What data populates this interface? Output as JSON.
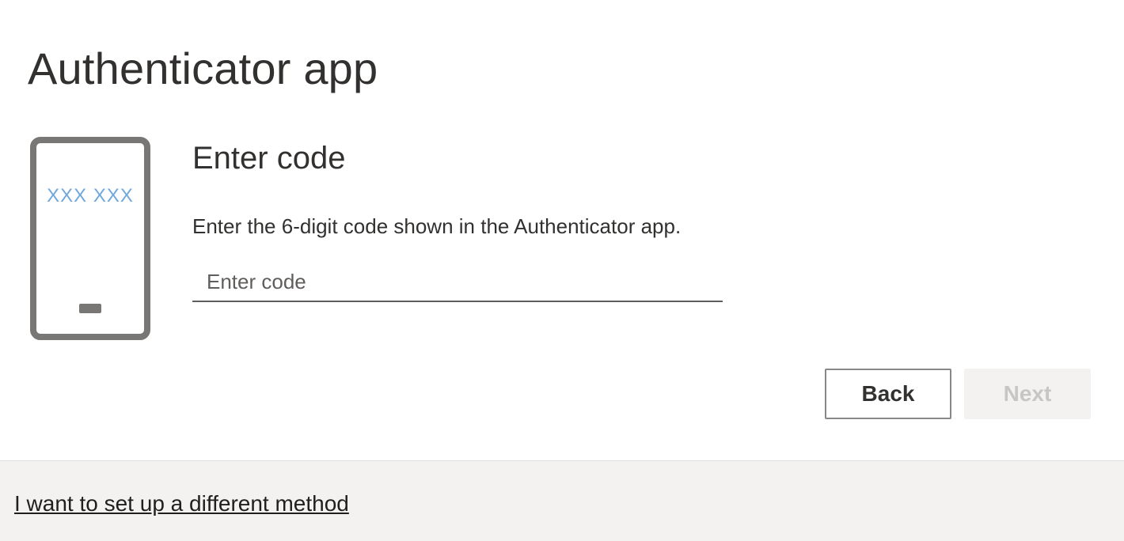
{
  "header": {
    "title": "Authenticator app"
  },
  "illustration": {
    "icon": "phone-icon",
    "code_placeholder": "XXX XXX",
    "accent_color": "#6fa8dc",
    "frame_color": "#797775"
  },
  "form": {
    "title": "Enter code",
    "description": "Enter the 6-digit code shown in the Authenticator app.",
    "code_input": {
      "value": "",
      "placeholder": "Enter code"
    }
  },
  "actions": {
    "back_label": "Back",
    "next_label": "Next",
    "next_disabled": true
  },
  "footer": {
    "link_label": "I want to set up a different method"
  }
}
